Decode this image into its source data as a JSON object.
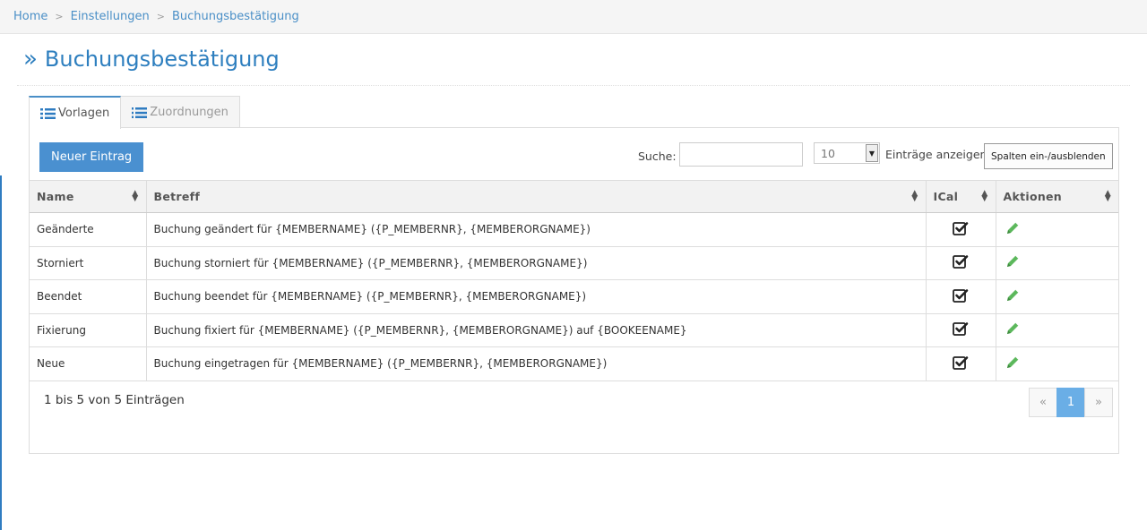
{
  "breadcrumb": {
    "items": [
      "Home",
      "Einstellungen",
      "Buchungsbestätigung"
    ],
    "separator": ">"
  },
  "page": {
    "title_icon": "»",
    "title": "Buchungsbestätigung"
  },
  "tabs": [
    {
      "label": "Vorlagen",
      "icon": "list-icon",
      "active": true
    },
    {
      "label": "Zuordnungen",
      "icon": "ordered-list-icon",
      "active": false
    }
  ],
  "toolbar": {
    "new_label": "Neuer Eintrag",
    "search_label": "Suche:",
    "search_value": "",
    "page_length": "10",
    "page_length_label": "Einträge anzeigen",
    "columns_toggle_label": "Spalten ein-/ausblenden"
  },
  "table": {
    "columns": [
      "Name",
      "Betreff",
      "ICal",
      "Aktionen"
    ],
    "rows": [
      {
        "name": "Geänderte",
        "subject": "Buchung geändert für {MEMBERNAME} ({P_MEMBERNR}, {MEMBERORGNAME})",
        "ical": true
      },
      {
        "name": "Storniert",
        "subject": "Buchung storniert für {MEMBERNAME} ({P_MEMBERNR}, {MEMBERORGNAME})",
        "ical": true
      },
      {
        "name": "Beendet",
        "subject": "Buchung beendet für {MEMBERNAME} ({P_MEMBERNR}, {MEMBERORGNAME})",
        "ical": true
      },
      {
        "name": "Fixierung",
        "subject": "Buchung fixiert für {MEMBERNAME} ({P_MEMBERNR}, {MEMBERORGNAME}) auf {BOOKEENAME}",
        "ical": true
      },
      {
        "name": "Neue",
        "subject": "Buchung eingetragen für {MEMBERNAME} ({P_MEMBERNR}, {MEMBERORGNAME})",
        "ical": true
      }
    ]
  },
  "footer": {
    "info": "1 bis 5 von 5 Einträgen",
    "pagination": {
      "prev": "«",
      "pages": [
        "1"
      ],
      "current": "1",
      "next": "»"
    }
  },
  "colors": {
    "accent": "#2e7fbf",
    "primary_button": "#4a90d0",
    "edit_icon": "#5cb85c",
    "active_page": "#6aaee6"
  }
}
